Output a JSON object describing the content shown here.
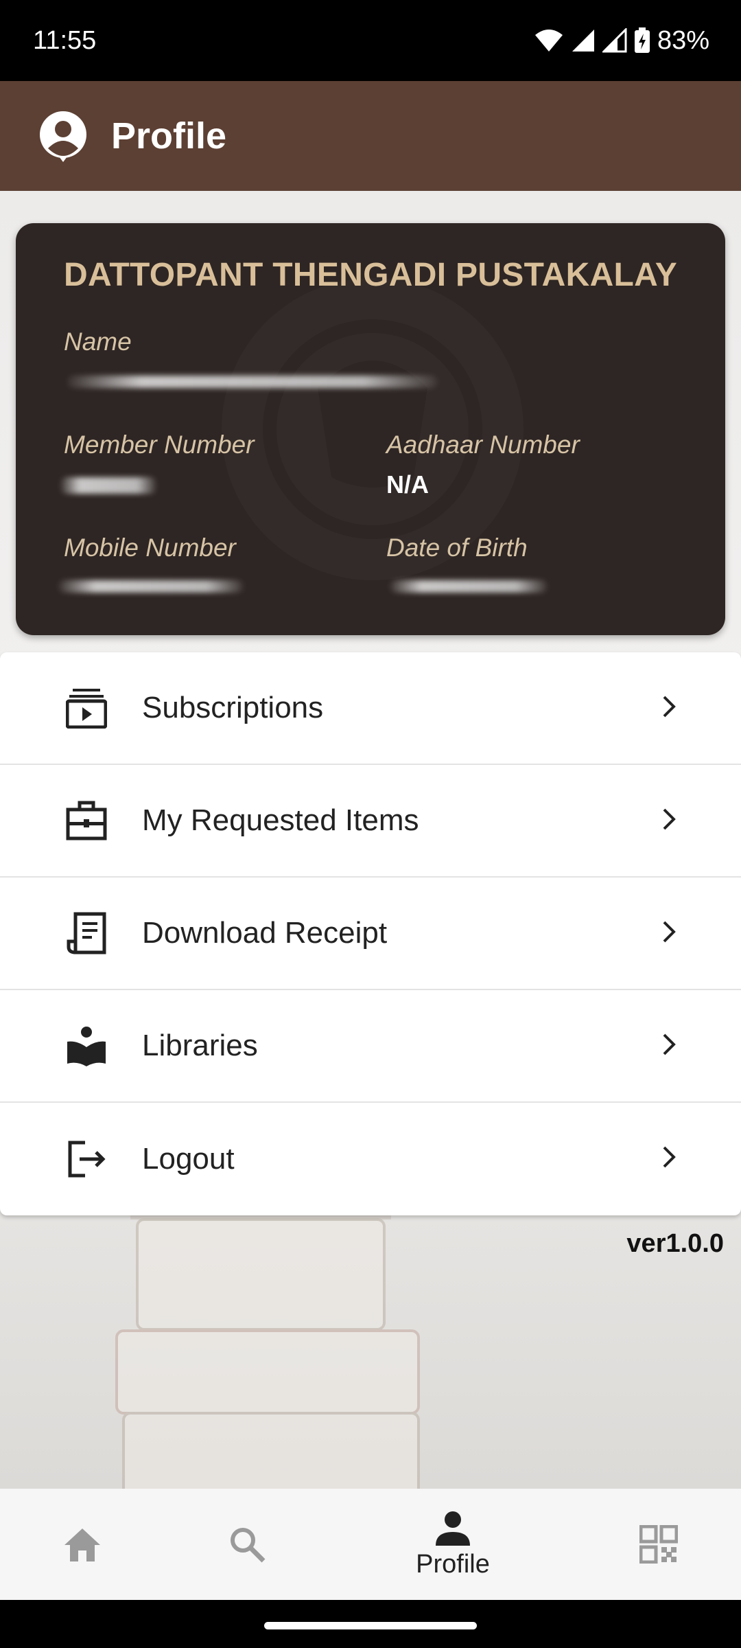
{
  "status_bar": {
    "time": "11:55",
    "battery": "83%"
  },
  "app_bar": {
    "title": "Profile",
    "icon": "account-circle-icon"
  },
  "card": {
    "library_name": "DATTOPANT THENGADI PUSTAKALAY",
    "name_label": "Name",
    "member_number_label": "Member Number",
    "aadhaar_label": "Aadhaar Number",
    "aadhaar_value": "N/A",
    "mobile_label": "Mobile Number",
    "dob_label": "Date of Birth"
  },
  "menu": {
    "items": [
      {
        "label": "Subscriptions",
        "icon": "subscriptions-icon"
      },
      {
        "label": "My Requested Items",
        "icon": "briefcase-icon"
      },
      {
        "label": "Download Receipt",
        "icon": "receipt-icon"
      },
      {
        "label": "Libraries",
        "icon": "reading-book-icon"
      },
      {
        "label": "Logout",
        "icon": "logout-icon"
      }
    ]
  },
  "version": "ver1.0.0",
  "bottom_nav": {
    "items": [
      {
        "icon": "home-icon",
        "label": ""
      },
      {
        "icon": "search-icon",
        "label": ""
      },
      {
        "icon": "person-icon",
        "label": "Profile",
        "active": true
      },
      {
        "icon": "qr-code-icon",
        "label": ""
      }
    ]
  },
  "colors": {
    "app_bar": "#5c4033",
    "card": "#2e2624",
    "card_title": "#d9bf99"
  }
}
